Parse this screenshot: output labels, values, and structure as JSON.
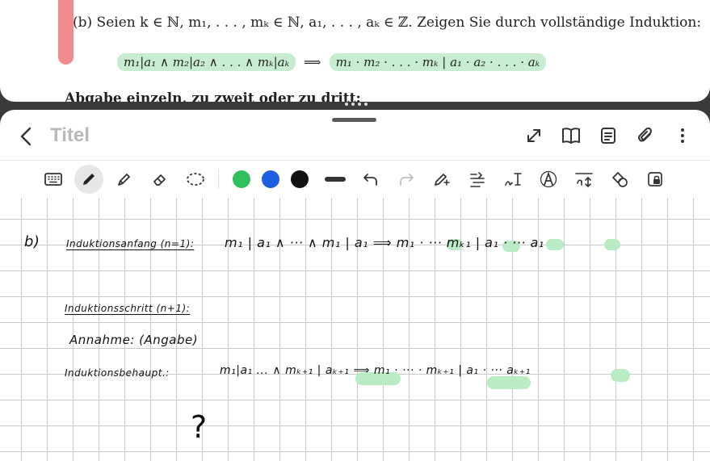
{
  "document": {
    "line1": "(b) Seien k ∈ ℕ, m₁, . . . , mₖ ∈ ℕ, a₁, . . . , aₖ ∈ ℤ. Zeigen Sie durch vollständige Induktion:",
    "formula_left": "m₁|a₁ ∧ m₂|a₂ ∧ . . . ∧ mₖ|aₖ",
    "implies": "⟹",
    "formula_right": "m₁ · m₂ · . . . · mₖ | a₁ · a₂ · . . . · aₖ",
    "cut_line": "Abgabe einzeln, zu zweit oder zu dritt:"
  },
  "header": {
    "title": "Titel"
  },
  "toolbar": {
    "colors": [
      "#2fbf5b",
      "#1e5ee0",
      "#111111"
    ]
  },
  "notes": {
    "b_label": "b)",
    "anfang_label": "Induktionsanfang (n=1):",
    "anfang_formula": "m₁ | a₁ ∧ ··· ∧ m₁ | a₁ ⟹ m₁ · ··· mₖ₁ | a₁ · ··· a₁",
    "schritt_label": "Induktionsschritt (n+1):",
    "annahme": "Annahme: (Angabe)",
    "behauptung_label": "Induktionsbehaupt.:",
    "behauptung_formula": "m₁|a₁ ... ∧ mₖ₊₁ | aₖ₊₁ ⟹ m₁ · ··· · mₖ₊₁ | a₁ · ··· aₖ₊₁",
    "question": "?"
  }
}
